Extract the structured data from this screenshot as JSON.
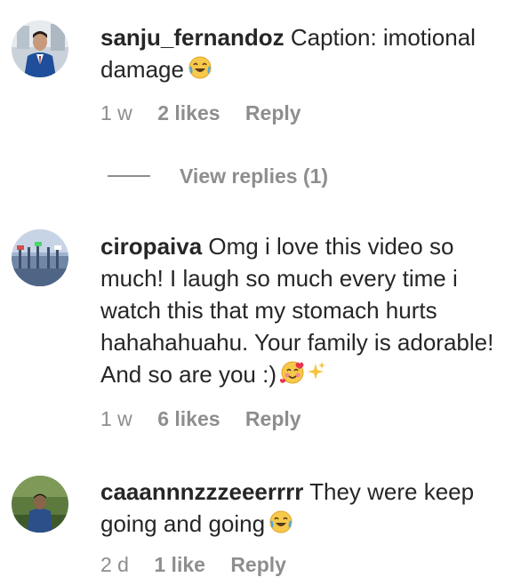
{
  "comments": [
    {
      "username": "sanju_fernandoz",
      "text": "Caption: imotional damage",
      "emoji": "😂",
      "emoji_icon": "face-with-tears-of-joy-icon",
      "time": "1 w",
      "likes": "2 likes",
      "reply": "Reply",
      "view_replies": "View replies (1)"
    },
    {
      "username": "ciropaiva",
      "text": "Omg i love this video so much! I laugh so much every time i watch this that my stomach hurts hahahahuahu. Your family is adorable! And so are you :)",
      "emoji": "🥰✨",
      "emoji_icon": "smiling-face-with-hearts-icon",
      "time": "1 w",
      "likes": "6 likes",
      "reply": "Reply"
    },
    {
      "username": "caaannnzzzeeerrrr",
      "text": "They were keep going and going",
      "emoji": "😂",
      "emoji_icon": "face-with-tears-of-joy-icon",
      "time": "2 d",
      "likes": "1 like",
      "reply": "Reply"
    }
  ],
  "colors": {
    "text": "#262626",
    "secondary": "#8e8e8e",
    "background": "#ffffff"
  }
}
